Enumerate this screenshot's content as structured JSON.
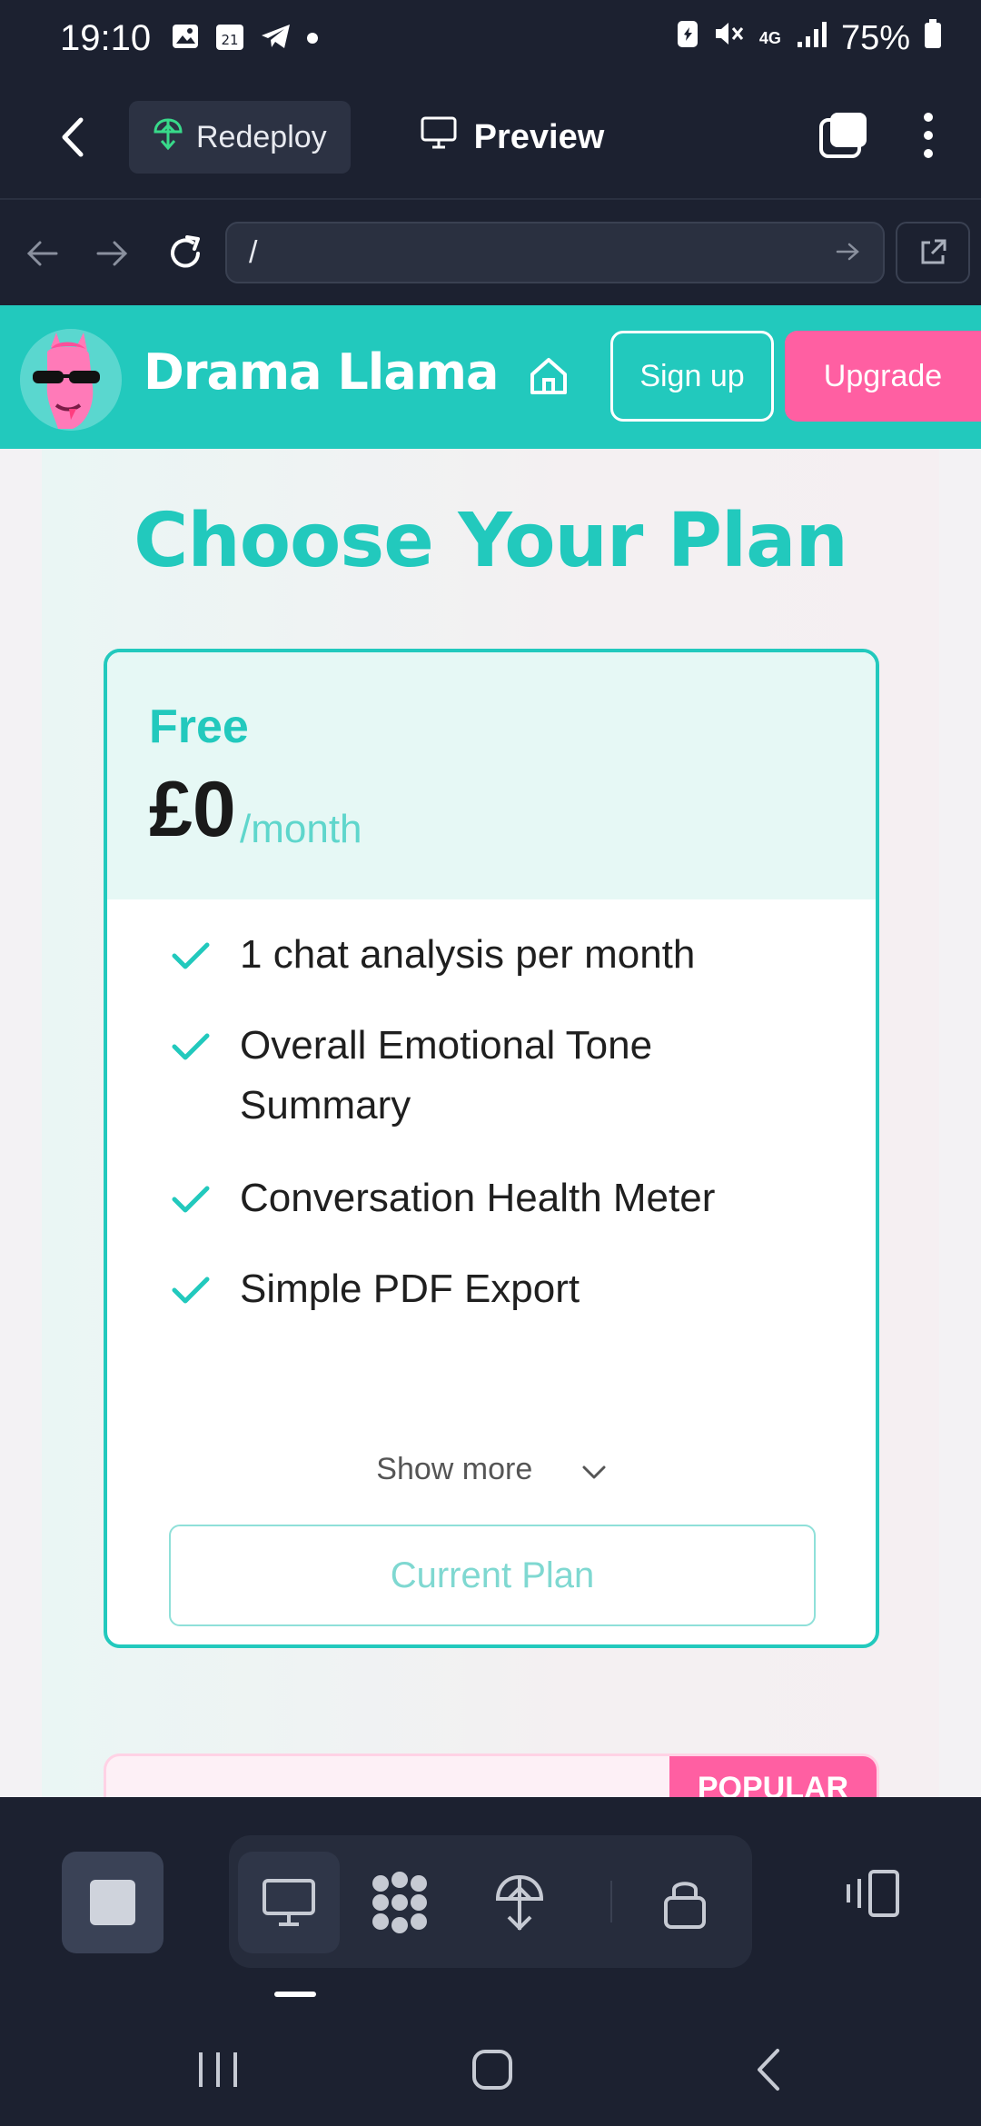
{
  "status_bar": {
    "time": "19:10",
    "calendar_day": "21",
    "network": "4G",
    "battery": "75%"
  },
  "app_toolbar": {
    "redeploy_label": "Redeploy",
    "preview_label": "Preview"
  },
  "url_bar": {
    "value": "/"
  },
  "site": {
    "brand": "Drama Llama",
    "signup_label": "Sign up",
    "upgrade_label": "Upgrade",
    "page_title": "Choose Your Plan",
    "plan": {
      "name": "Free",
      "price": "£0",
      "period": "/month",
      "features": [
        "1 chat analysis per month",
        "Overall Emotional Tone Summary",
        "Conversation Health Meter",
        "Simple PDF Export"
      ],
      "show_more_label": "Show more",
      "button_label": "Current Plan"
    },
    "next_plan_badge": "POPULAR"
  },
  "colors": {
    "accent": "#22c9bd",
    "pink": "#ff5fa2",
    "chrome": "#1c2130"
  }
}
